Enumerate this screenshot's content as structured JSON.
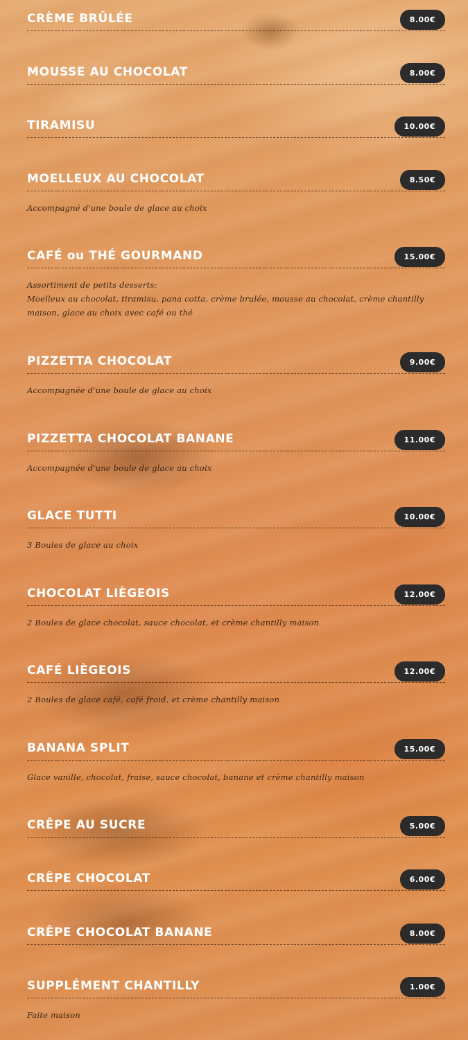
{
  "menu": {
    "items": [
      {
        "name": "CRÈME BRÛLÉE",
        "price": "8.00€"
      },
      {
        "name": "MOUSSE AU CHOCOLAT",
        "price": "8.00€"
      },
      {
        "name": "TIRAMISU",
        "price": "10.00€"
      },
      {
        "name": "MOELLEUX AU CHOCOLAT",
        "price": "8.50€",
        "desc": [
          "Accompagné d'une boule de glace au choix"
        ]
      },
      {
        "name": "CAFÉ ou THÉ GOURMAND",
        "price": "15.00€",
        "desc": [
          "Assortiment de petits desserts:",
          "Moelleux au chocolat, tiramisu, pana cotta, crème brulée, mousse au chocolat, crème chantilly",
          "maison, glace au choix avec café ou thé"
        ]
      },
      {
        "name": "PIZZETTA CHOCOLAT",
        "price": "9.00€",
        "desc": [
          "Accompagnée d'une boule de glace au choix"
        ]
      },
      {
        "name": "PIZZETTA CHOCOLAT BANANE",
        "price": "11.00€",
        "desc": [
          "Accompagnée d'une boule de glace au choix"
        ]
      },
      {
        "name": "GLACE TUTTI",
        "price": "10.00€",
        "desc": [
          "3 Boules de glace au choix"
        ]
      },
      {
        "name": "CHOCOLAT LIÈGEOIS",
        "price": "12.00€",
        "desc": [
          "2 Boules de glace chocolat, sauce chocolat, et crème chantilly maison"
        ]
      },
      {
        "name": "CAFÉ LIÈGEOIS",
        "price": "12.00€",
        "desc": [
          "2 Boules de glace café, café froid, et crème chantilly maison"
        ]
      },
      {
        "name": "BANANA SPLIT",
        "price": "15.00€",
        "desc": [
          "Glace vanille, chocolat, fraise, sauce chocolat, banane et crème chantilly maison"
        ]
      },
      {
        "name": "CRÊPE AU SUCRE",
        "price": "5.00€"
      },
      {
        "name": "CRÊPE CHOCOLAT",
        "price": "6.00€"
      },
      {
        "name": "CRÊPE CHOCOLAT BANANE",
        "price": "8.00€"
      },
      {
        "name": "SUPPLÉMENT CHANTILLY",
        "price": "1.00€",
        "desc": [
          "Faite maison"
        ]
      }
    ]
  },
  "colors": {
    "price_badge": "#2b2b2b",
    "item_name": "#ffffff",
    "description": "#3a2412"
  }
}
